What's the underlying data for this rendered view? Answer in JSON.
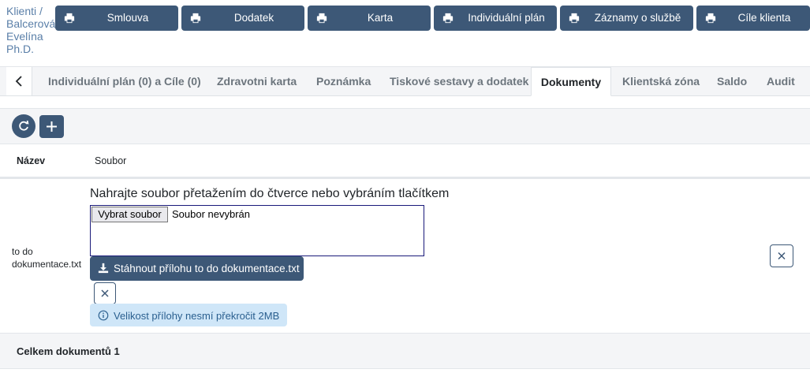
{
  "breadcrumb": {
    "root": "Klienti /",
    "line1": "Balcerová",
    "line2": "Evelína",
    "line3": "Ph.D."
  },
  "top_buttons": {
    "contract": "Smlouva",
    "amendment": "Dodatek",
    "card": "Karta",
    "individual_plan": "Individuální plán",
    "service_records": "Záznamy o službě",
    "client_goals": "Cíle klienta"
  },
  "tabs": {
    "plan": "Individuální plán (0) a Cíle (0)",
    "health": "Zdravotni karta",
    "note": "Poznámka",
    "print": "Tiskové sestavy a dodatek",
    "documents": "Dokumenty",
    "zone": "Klientská zóna",
    "balance": "Saldo",
    "audit": "Audit"
  },
  "table": {
    "col_name": "Název",
    "col_file": "Soubor",
    "row": {
      "name_line1": "to do",
      "name_line2": "dokumentace.txt",
      "instruction": "Nahrajte soubor přetažením do čtverce nebo vybráním tlačítkem",
      "choose_file": "Vybrat soubor",
      "no_file": "Soubor nevybrán",
      "download": "Stáhnout přílohu to do dokumentace.txt",
      "size_note": "Velikost přílohy nesmí překročit 2MB"
    }
  },
  "footer": {
    "total": "Celkem dokumentů 1"
  },
  "colors": {
    "primary": "#3d5877",
    "info_bg": "#cfe6f8",
    "link": "#5a7fa8"
  }
}
